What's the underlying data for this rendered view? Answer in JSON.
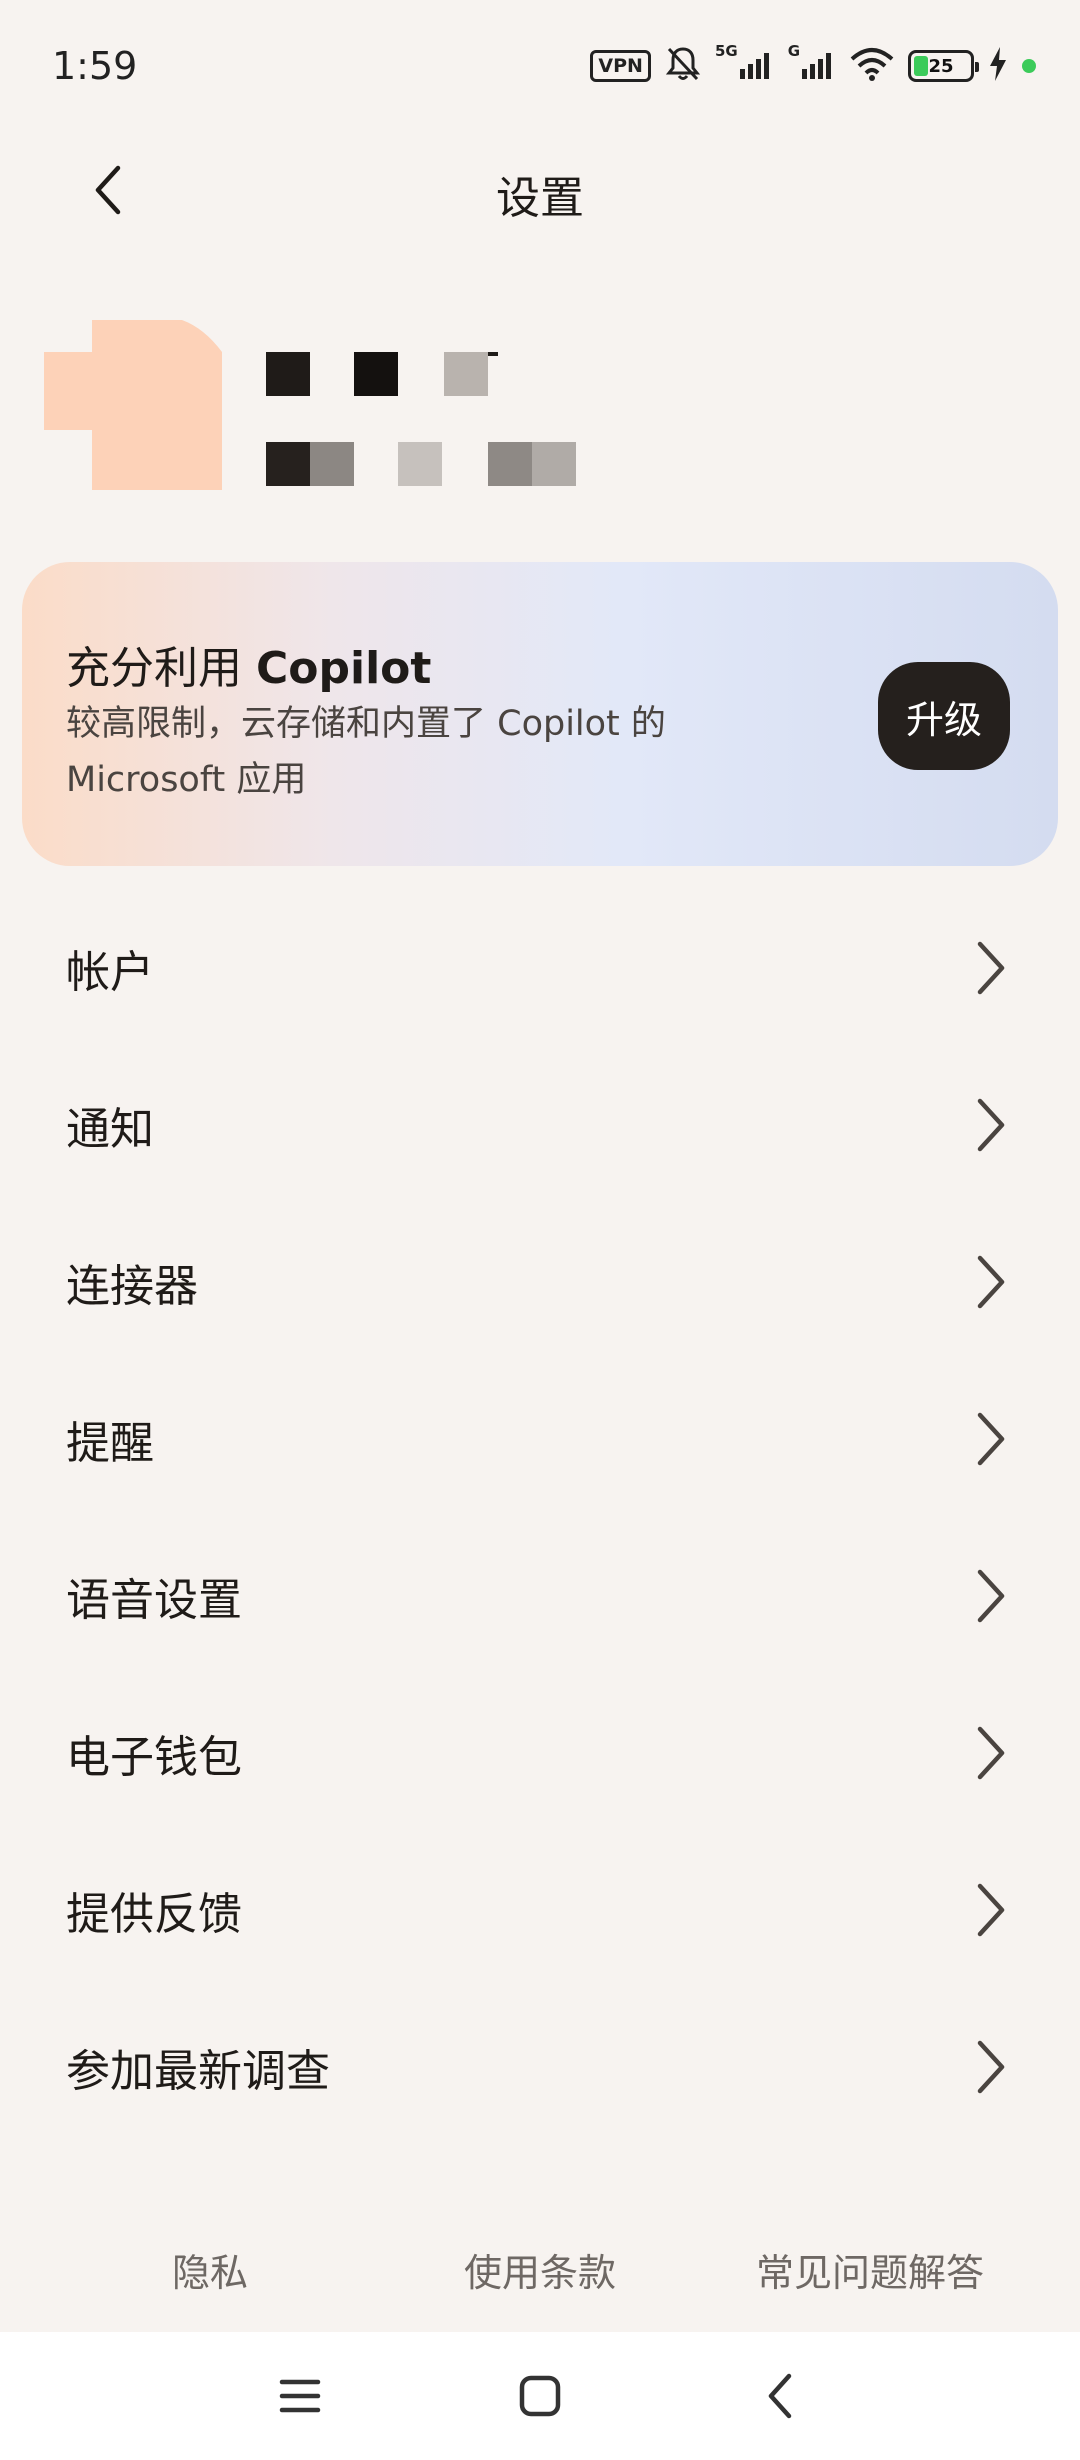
{
  "status_bar": {
    "time": "1:59",
    "vpn": "VPN",
    "sim1_label": "5G",
    "sim2_label": "G",
    "battery_level": "25",
    "battery_fraction": 0.25,
    "icons": [
      "vpn-icon",
      "bell-off-icon",
      "signal-5g-icon",
      "signal-icon",
      "wifi-icon",
      "battery-icon",
      "charging-icon"
    ]
  },
  "header": {
    "title": "设置",
    "back_icon": "chevron-left-icon"
  },
  "profile": {
    "avatar_color": "#fdd2b8"
  },
  "upgrade_card": {
    "title_prefix": "充分利用 ",
    "title_brand": "Copilot",
    "description": "较高限制，云存储和内置了 Copilot 的 Microsoft 应用",
    "button_label": "升级"
  },
  "settings": {
    "items": [
      {
        "label": "帐户"
      },
      {
        "label": "通知"
      },
      {
        "label": "连接器"
      },
      {
        "label": "提醒"
      },
      {
        "label": "语音设置"
      },
      {
        "label": "电子钱包"
      },
      {
        "label": "提供反馈"
      },
      {
        "label": "参加最新调查"
      }
    ]
  },
  "footer": {
    "privacy": "隐私",
    "terms": "使用条款",
    "faq": "常见问题解答"
  },
  "nav_bar": {
    "icons": [
      "menu-icon",
      "home-icon",
      "back-icon"
    ]
  },
  "colors": {
    "background": "#f7f3f0",
    "button_dark": "#25201d",
    "battery_green": "#3ccb5a"
  }
}
